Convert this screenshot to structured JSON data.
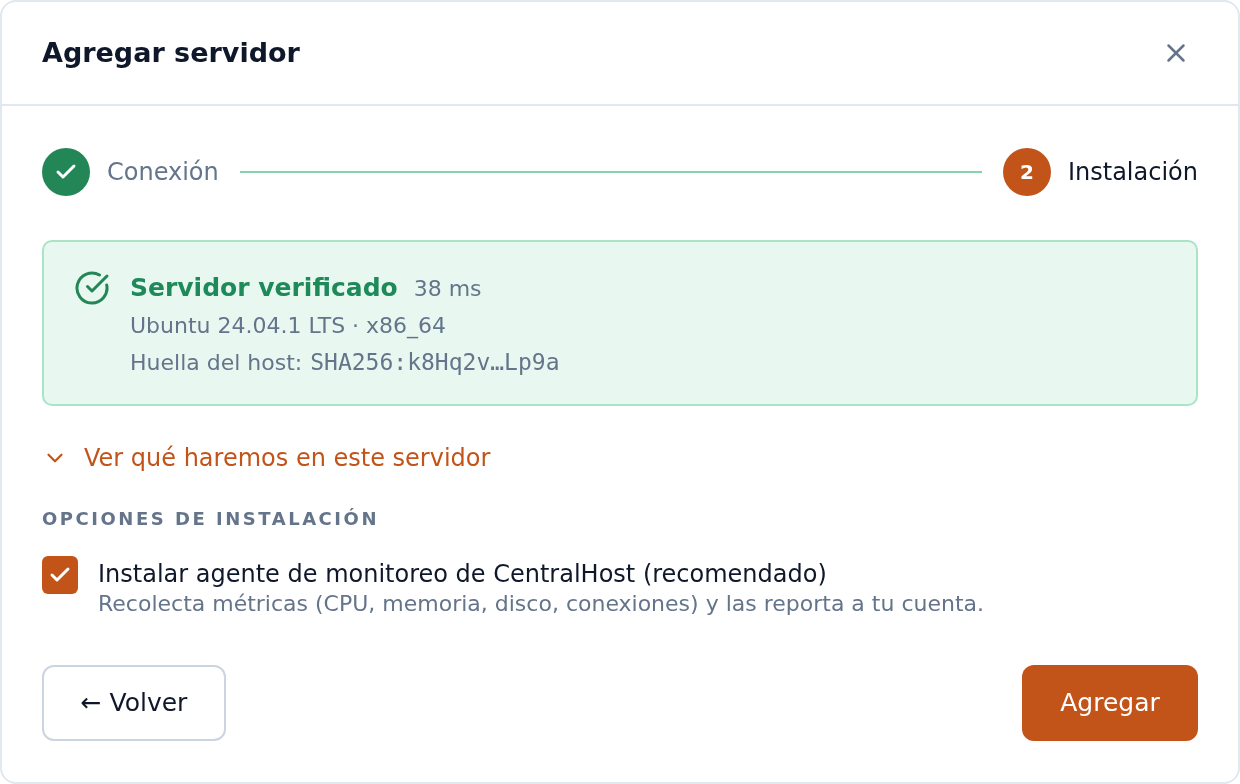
{
  "dialog": {
    "title": "Agregar servidor"
  },
  "stepper": {
    "steps": [
      {
        "label": "Conexión",
        "completed": true,
        "selected": false
      },
      {
        "label": "Instalación",
        "number": "2",
        "completed": false,
        "selected": true
      }
    ]
  },
  "verification": {
    "title": "Servidor verificado",
    "latency": "38 ms",
    "system": "Ubuntu 24.04.1 LTS · x86_64",
    "fingerprint_label": "Huella del host:",
    "fingerprint": "SHA256:k8Hq2v…Lp9a"
  },
  "disclosure": {
    "label": "Ver qué haremos en este servidor",
    "expanded": false
  },
  "install_options": {
    "heading": "OPCIONES DE INSTALACIÓN",
    "options": [
      {
        "label": "Instalar agente de monitoreo de CentralHost (recomendado)",
        "description": "Recolecta métricas (CPU, memoria, disco, conexiones) y las reporta a tu cuenta.",
        "checked": true
      }
    ]
  },
  "buttons": [
    {
      "label": "← Volver",
      "kind": "secondary"
    },
    {
      "label": "Agregar",
      "kind": "primary"
    }
  ]
}
